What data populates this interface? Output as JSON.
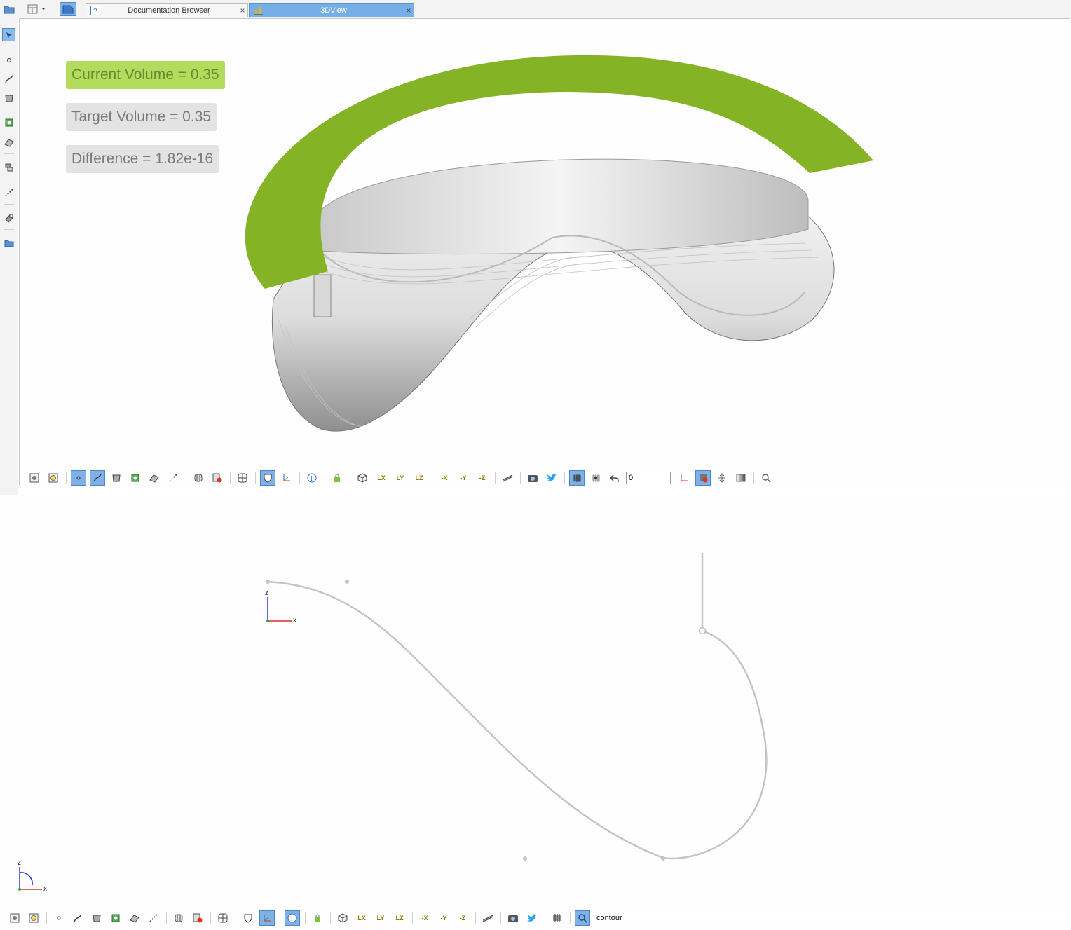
{
  "tabs": [
    {
      "label": "Documentation Browser",
      "close": "×"
    },
    {
      "label": "3DView",
      "close": "×"
    }
  ],
  "view3d": {
    "current_volume": "Current Volume = 0.35",
    "target_volume": "Target Volume = 0.35",
    "difference": "Difference = 1.82e-16",
    "colors": {
      "accent_green": "#84b325",
      "badge_green": "#b3dc5c",
      "surface_gray": "#d9d9d9"
    }
  },
  "toolbar3d": {
    "frame_input": "0"
  },
  "sketch": {
    "axis_z": "z",
    "axis_x": "x",
    "mini_axis_z": "z",
    "mini_axis_x": "x"
  },
  "toolbar2d": {
    "search_value": "contour"
  },
  "axis_labels": {
    "lx": "LX",
    "ly": "LY",
    "lz": "LZ",
    "nx": "-X",
    "ny": "-Y",
    "nz": "-Z"
  },
  "icons": [
    "folder-icon",
    "layout-icon",
    "help-icon",
    "chart-icon",
    "select-icon",
    "point-icon",
    "curve-icon",
    "surface-icon",
    "patch-icon",
    "solid-icon",
    "stack-icon",
    "dotted-line-icon",
    "eraser-icon",
    "camera-icon",
    "twitter-icon",
    "grid-icon",
    "undo-icon",
    "search-icon",
    "lock-icon",
    "cube-icon",
    "info-icon"
  ]
}
